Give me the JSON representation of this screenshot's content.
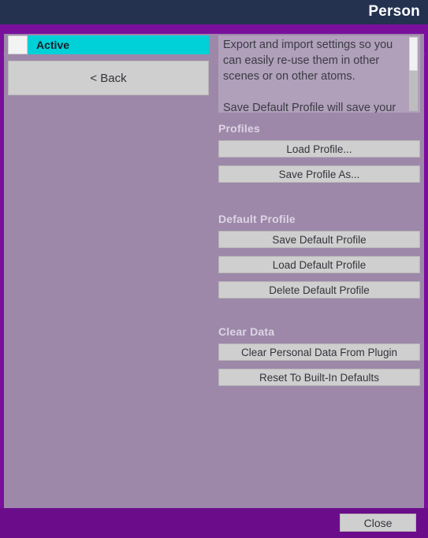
{
  "window": {
    "title": "Person"
  },
  "left_panel": {
    "active_toggle": {
      "label": "Active",
      "checked": false
    },
    "back_button": "< Back"
  },
  "help_panel": {
    "text": "Export and import settings so you can easily re-use them in other scenes or on other atoms.\n\nSave Default Profile will save your settings so that whenever you load this"
  },
  "sections": [
    {
      "title": "Profiles",
      "buttons": [
        "Load Profile...",
        "Save Profile As..."
      ]
    },
    {
      "title": "Default Profile",
      "buttons": [
        "Save Default Profile",
        "Load Default Profile",
        "Delete Default Profile"
      ]
    },
    {
      "title": "Clear Data",
      "buttons": [
        "Clear Personal Data From Plugin",
        "Reset To Built-In Defaults"
      ]
    }
  ],
  "footer": {
    "close_button": "Close"
  },
  "colors": {
    "titlebar": "#243250",
    "frame": "#7a0f9c",
    "panel": "#9d88a9",
    "accent_cyan": "#00d0d8",
    "button": "#cfcfcf",
    "footer": "#6b0d8a"
  }
}
